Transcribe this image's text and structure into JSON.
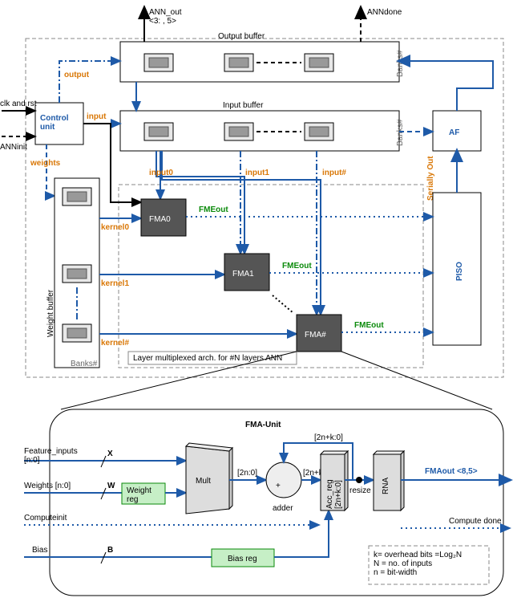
{
  "top": {
    "ann_out": "ANN_out\n<3: , 5>",
    "output_buffer": "Output buffer",
    "anndone": "ANNdone",
    "input_buffer": "Input buffer",
    "banks_a": "Banks#",
    "banks_b": "Banks#",
    "banks_c": "Banks#",
    "clk_rst": "clk and rst",
    "anninit": "ANNinit",
    "control_unit": "Control\nunit",
    "output": "output",
    "input": "input",
    "weights": "weights",
    "weight_buffer": "Weight buffer",
    "kernel0": "kernel0",
    "kernel1": "kernel1",
    "kernelN": "kernel#",
    "input0": "input0",
    "input1": "input1",
    "inputN": "input#",
    "fma0": "FMA0",
    "fma1": "FMA1",
    "fmaN": "FMA#",
    "fme_out0": "FMEout",
    "fme_out1": "FMEout",
    "fme_outN": "FMEout",
    "piso": "PISO",
    "af": "AF",
    "serially_out": "Serially Out",
    "layer_note": "Layer multiplexed arch. for #N layers ANN"
  },
  "bottom": {
    "title": "FMA-Unit",
    "feature_inputs": "Feature_inputs\n[n:0]",
    "weights": "Weights [n:0]",
    "computeinit": "Computeinit",
    "bias": "Bias",
    "x": "X",
    "w": "W",
    "b": "B",
    "weight_reg": "Weight\nreg",
    "mult": "Mult",
    "adder": "adder",
    "add_sym": "+",
    "acc_reg": "Acc_reg\n[2n+k:0]",
    "rna": "RNA",
    "bias_reg": "Bias reg",
    "resize": "resize",
    "fma_out": "FMAout <8,5>",
    "compute_done": "Compute done",
    "bus_2n0": "[2n:0]",
    "bus_2nk": "[2n+k]",
    "bus_2nk0": "[2n+k:0]",
    "note": "k= overhead bits =Log₂N\nN = no. of inputs\nn = bit-width"
  }
}
